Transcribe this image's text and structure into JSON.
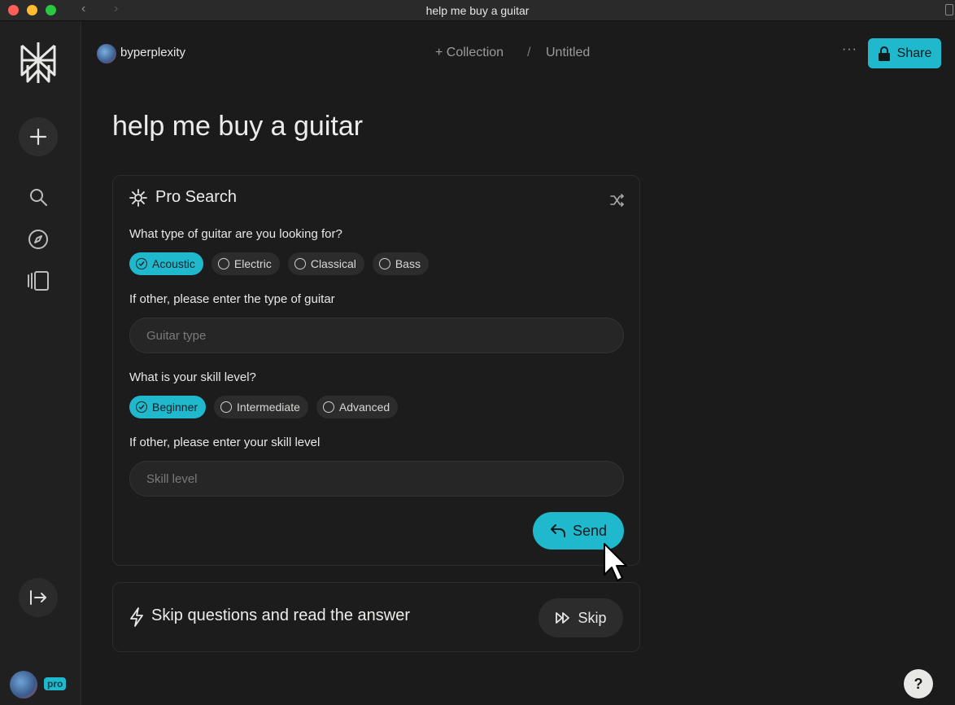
{
  "window": {
    "title": "help me buy a guitar"
  },
  "header": {
    "username": "byperplexity",
    "collection_label": "+ Collection",
    "separator": "/",
    "untitled_label": "Untitled",
    "more_label": "···",
    "share_label": "Share"
  },
  "page": {
    "title": "help me buy a guitar"
  },
  "pro_search": {
    "heading": "Pro Search",
    "q1": {
      "label": "What type of guitar are you looking for?",
      "options": [
        "Acoustic",
        "Electric",
        "Classical",
        "Bass"
      ],
      "selected": "Acoustic"
    },
    "q1_other": {
      "label": "If other, please enter the type of guitar",
      "placeholder": "Guitar type"
    },
    "q2": {
      "label": "What is your skill level?",
      "options": [
        "Beginner",
        "Intermediate",
        "Advanced"
      ],
      "selected": "Beginner"
    },
    "q2_other": {
      "label": "If other, please enter your skill level",
      "placeholder": "Skill level"
    },
    "send_label": "Send"
  },
  "skip": {
    "text": "Skip questions and read the answer",
    "button_label": "Skip"
  },
  "sidebar": {
    "pro_badge": "pro",
    "icons": [
      "perplexity-logo-icon",
      "plus-icon",
      "search-icon",
      "compass-icon",
      "library-icon",
      "expand-sidebar-icon"
    ]
  },
  "help_label": "?",
  "colors": {
    "accent": "#1fb8cd",
    "background": "#1b1b1b",
    "sidebar": "#202020"
  }
}
